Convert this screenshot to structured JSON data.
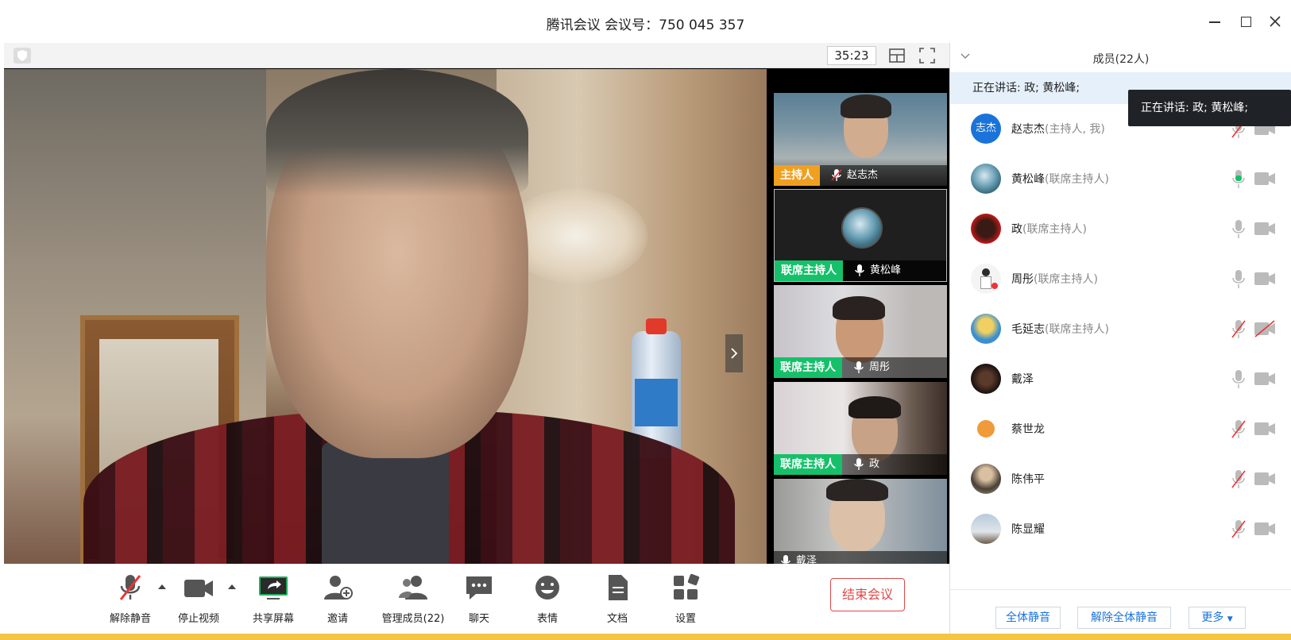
{
  "window": {
    "title": "腾讯会议 会议号：750 045 357"
  },
  "video_toolbar": {
    "timer": "35:23"
  },
  "thumbnails": [
    {
      "tag": "主持人",
      "name": "赵志杰",
      "muted": true
    },
    {
      "tag": "联席主持人",
      "name": "黄松峰",
      "muted": false
    },
    {
      "tag": "联席主持人",
      "name": "周彤",
      "muted": false
    },
    {
      "tag": "联席主持人",
      "name": "政",
      "muted": false
    },
    {
      "tag": "",
      "name": "戴泽",
      "muted": false
    }
  ],
  "bottom_toolbar": {
    "unmute": "解除静音",
    "stop_video": "停止视频",
    "share_screen": "共享屏幕",
    "invite": "邀请",
    "manage_members": "管理成员(22)",
    "chat": "聊天",
    "emoji": "表情",
    "docs": "文档",
    "settings": "设置",
    "end_meeting": "结束会议"
  },
  "panel": {
    "title": "成员(22人)",
    "speaking": "正在讲话: 政; 黄松峰;",
    "tooltip": "正在讲话: 政; 黄松峰;",
    "members": [
      {
        "name": "赵志杰",
        "role": "(主持人, 我)",
        "avatar_text": "志杰",
        "mic": "muted",
        "cam": "on"
      },
      {
        "name": "黄松峰",
        "role": "(联席主持人)",
        "avatar_text": "",
        "mic": "active",
        "cam": "on"
      },
      {
        "name": "政",
        "role": "(联席主持人)",
        "avatar_text": "",
        "mic": "on",
        "cam": "on"
      },
      {
        "name": "周彤",
        "role": "(联席主持人)",
        "avatar_text": "",
        "mic": "on",
        "cam": "on"
      },
      {
        "name": "毛延志",
        "role": "(联席主持人)",
        "avatar_text": "",
        "mic": "muted",
        "cam": "off"
      },
      {
        "name": "戴泽",
        "role": "",
        "avatar_text": "",
        "mic": "on",
        "cam": "on"
      },
      {
        "name": "蔡世龙",
        "role": "",
        "avatar_text": "",
        "mic": "muted",
        "cam": "on"
      },
      {
        "name": "陈伟平",
        "role": "",
        "avatar_text": "",
        "mic": "muted",
        "cam": "on"
      },
      {
        "name": "陈显耀",
        "role": "",
        "avatar_text": "",
        "mic": "muted",
        "cam": "on"
      }
    ],
    "mute_all": "全体静音",
    "unmute_all": "解除全体静音",
    "more": "更多"
  },
  "colors": {
    "accent": "#1a73d9",
    "host_tag": "#f0a020",
    "cohost_tag": "#16c06a",
    "end_red": "#e04848",
    "speaking_bg": "#e5f0fb"
  }
}
